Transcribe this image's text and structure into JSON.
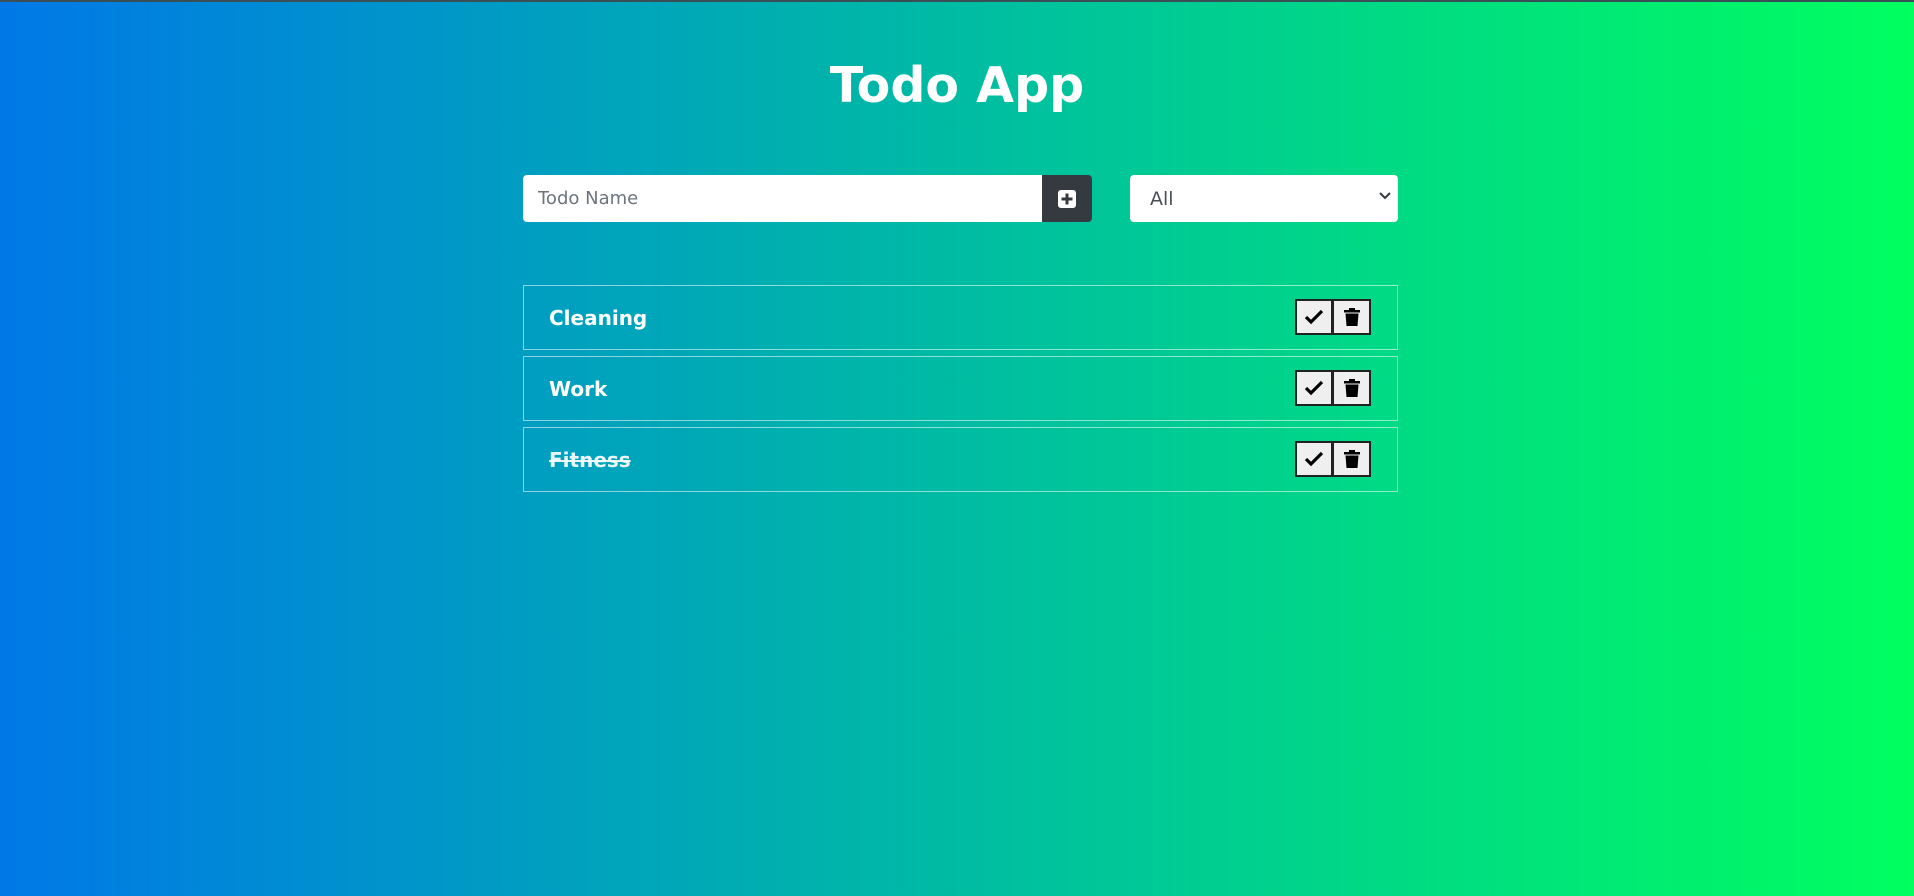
{
  "app": {
    "title": "Todo App"
  },
  "form": {
    "input_placeholder": "Todo Name",
    "input_value": "",
    "add_icon": "plus-square-icon"
  },
  "filter": {
    "selected": "All",
    "options": [
      "All"
    ]
  },
  "todos": [
    {
      "label": "Cleaning",
      "completed": false
    },
    {
      "label": "Work",
      "completed": false
    },
    {
      "label": "Fitness",
      "completed": true
    }
  ],
  "icons": {
    "complete": "check-icon",
    "delete": "trash-icon"
  },
  "colors": {
    "gradient_start": "#0078e7",
    "gradient_end": "#00ff5f",
    "add_button": "#343a40"
  }
}
